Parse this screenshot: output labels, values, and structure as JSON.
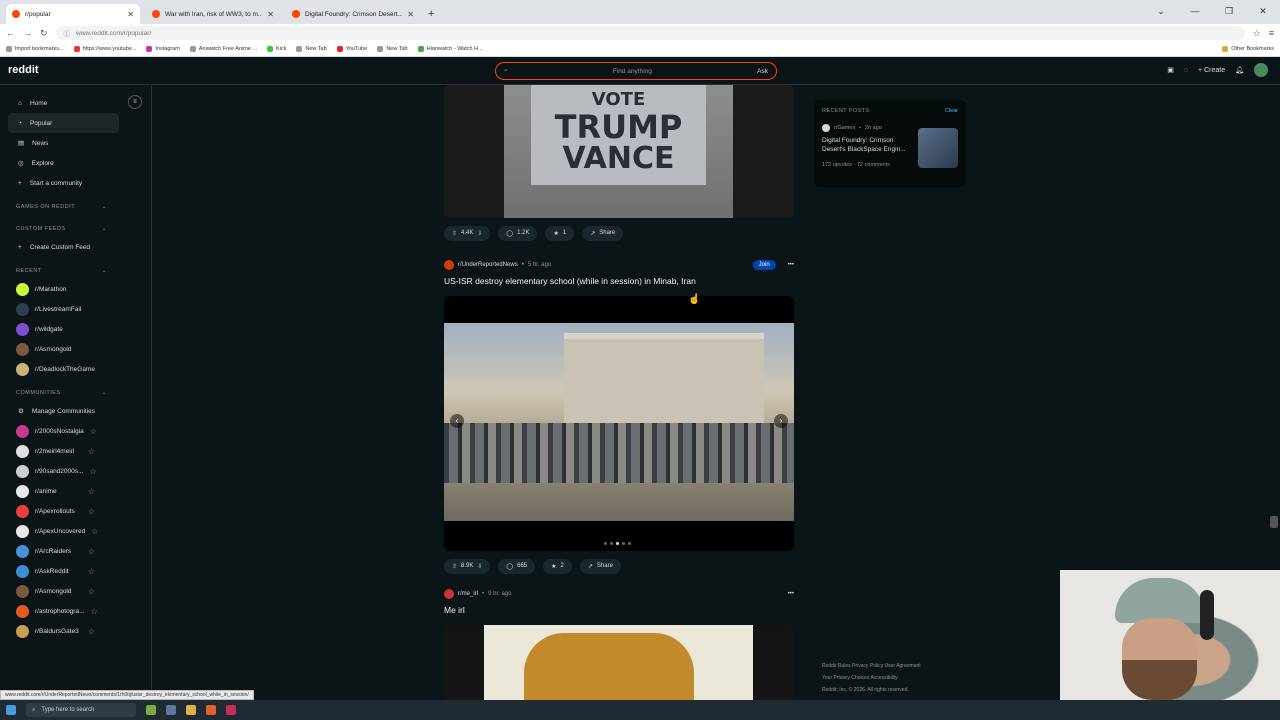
{
  "browser": {
    "tabs": [
      {
        "title": "r/popular",
        "active": true
      },
      {
        "title": "War with Iran, risk of WW3, to m..."
      },
      {
        "title": "Digital Foundry: Crimson Desert..."
      }
    ],
    "url": "www.reddit.com/r/popular/",
    "bookmarks": [
      "Import bookmarks...",
      "https://www.youtube...",
      "Instagram",
      "Aniwatch Free Anime ...",
      "Kick",
      "New Tab",
      "YouTube",
      "New Tab",
      "Hianwatch - Watch H..."
    ],
    "other_bookmarks": "Other Bookmarks"
  },
  "header": {
    "logo": "reddit",
    "search_placeholder": "Find anything",
    "ask_label": "Ask",
    "create_label": "Create"
  },
  "sidebar": {
    "nav": [
      {
        "label": "Home",
        "icon": "home-icon"
      },
      {
        "label": "Popular",
        "icon": "popular-icon",
        "active": true
      },
      {
        "label": "News",
        "icon": "news-icon"
      },
      {
        "label": "Explore",
        "icon": "explore-icon"
      },
      {
        "label": "Start a community",
        "icon": "plus-icon"
      }
    ],
    "games_section": "GAMES ON REDDIT",
    "custom_feeds_section": "CUSTOM FEEDS",
    "create_custom_feed": "Create Custom Feed",
    "recent_section": "RECENT",
    "recent": [
      {
        "label": "r/Marathon",
        "color": "#c6ff3a"
      },
      {
        "label": "r/LivestreamFail",
        "color": "#2c3e50"
      },
      {
        "label": "r/wildgate",
        "color": "#7b4fd1"
      },
      {
        "label": "r/Asmongold",
        "color": "#7a5a3a"
      },
      {
        "label": "r/DeadlockTheGame",
        "color": "#c9b27a"
      }
    ],
    "communities_section": "COMMUNITIES",
    "manage_communities": "Manage Communities",
    "communities": [
      {
        "label": "r/2000sNostalgia",
        "color": "#c43a8a"
      },
      {
        "label": "r/2meirl4meirl",
        "color": "#e0e0e0"
      },
      {
        "label": "r/90sand2000s...",
        "color": "#cfcfcf"
      },
      {
        "label": "r/anime",
        "color": "#e8e8e8"
      },
      {
        "label": "r/Apexrollouts",
        "color": "#e84040"
      },
      {
        "label": "r/ApexUncovered",
        "color": "#e8e8e8"
      },
      {
        "label": "r/ArcRaiders",
        "color": "#4a90d9"
      },
      {
        "label": "r/AskReddit",
        "color": "#3d8fd1"
      },
      {
        "label": "r/Asmongold",
        "color": "#7a5a3a"
      },
      {
        "label": "r/astrophotogra...",
        "color": "#e25a20"
      },
      {
        "label": "r/BaldursGate3",
        "color": "#c8a050"
      }
    ]
  },
  "feed": {
    "post1": {
      "sign_lines": [
        "VOTE",
        "TRUMP",
        "VANCE"
      ],
      "upvotes": "4.4K",
      "comments": "1.2K",
      "awards": "1",
      "share": "Share"
    },
    "post2": {
      "subreddit": "r/UnderReportedNews",
      "time": "5 hr. ago",
      "join": "Join",
      "title": "US-ISR destroy elementary school (while in session) in Minab, Iran",
      "upvotes": "8.9K",
      "comments": "665",
      "awards": "2",
      "share": "Share"
    },
    "post3": {
      "subreddit": "r/me_irl",
      "time": "9 hr. ago",
      "title": "Me irl"
    }
  },
  "recent_posts": {
    "heading": "RECENT POSTS",
    "clear": "Clear",
    "subreddit": "r/Games",
    "time": "2h ago",
    "title": "Digital Foundry: Crimson Desert's BlackSpace Engin...",
    "upvotes": "172 upvotes",
    "comments": "72 comments"
  },
  "footer": {
    "links1": "Reddit Rules   Privacy Policy   User Agreement",
    "links2": "Your Privacy Choices   Accessibility",
    "copyright": "Reddit, Inc. © 2026. All rights reserved."
  },
  "status_url": "www.reddit.com/r/UnderReportedNews/comments/1rh0tij/usisr_destroy_elementary_school_while_in_session/",
  "taskbar": {
    "search_placeholder": "Type here to search"
  }
}
